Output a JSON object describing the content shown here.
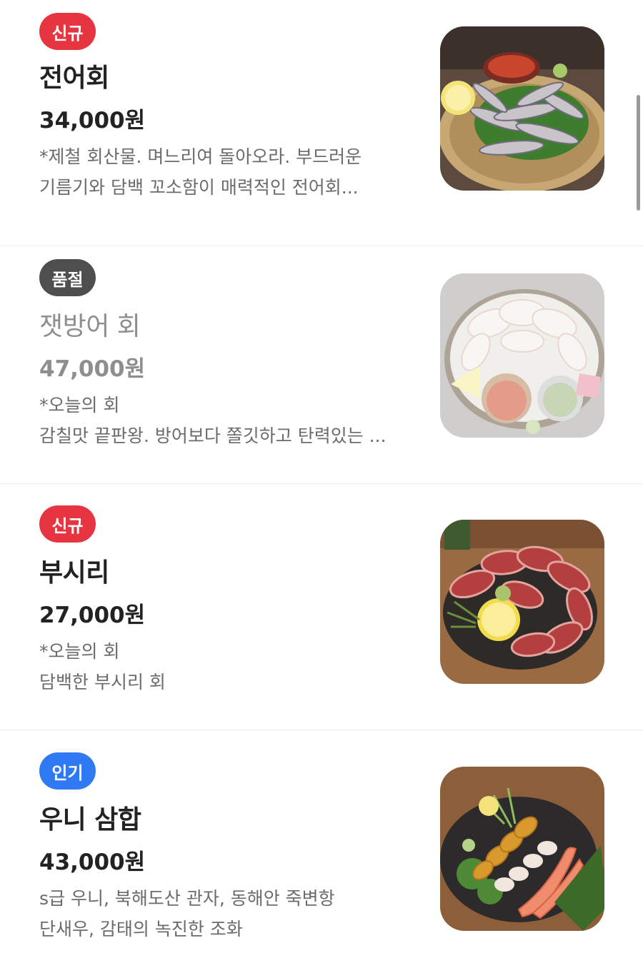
{
  "menu": {
    "items": [
      {
        "badge": "신규",
        "name": "전어회",
        "price": "34,000원",
        "desc_line1": "*제철 회산물. 며느리여 돌아오라.  부드러운",
        "desc_line2": "기름기와 담백 꼬소함이 매력적인 전어회...",
        "image_alt": "gizzard-shad-sashimi-photo"
      },
      {
        "badge": "품절",
        "name": "잿방어 회",
        "price": "47,000원",
        "desc_line1": "*오늘의 회",
        "desc_line2": "감칠맛 끝판왕. 방어보다 쫄깃하고 탄력있는 ...",
        "image_alt": "amberjack-sashimi-photo"
      },
      {
        "badge": "신규",
        "name": "부시리",
        "price": "27,000원",
        "desc_line1": "*오늘의 회",
        "desc_line2": "담백한 부시리 회",
        "image_alt": "yellowtail-sashimi-photo"
      },
      {
        "badge": "인기",
        "name": "우니 삼합",
        "price": "43,000원",
        "desc_line1": "s급 우니, 북해도산 관자, 동해안 죽변항",
        "desc_line2": "단새우, 감태의 녹진한 조화",
        "image_alt": "sea-urchin-trio-photo"
      }
    ]
  },
  "colors": {
    "badge_new": "#e63540",
    "badge_soldout": "#4e4e4e",
    "badge_popular": "#2f7af2"
  }
}
